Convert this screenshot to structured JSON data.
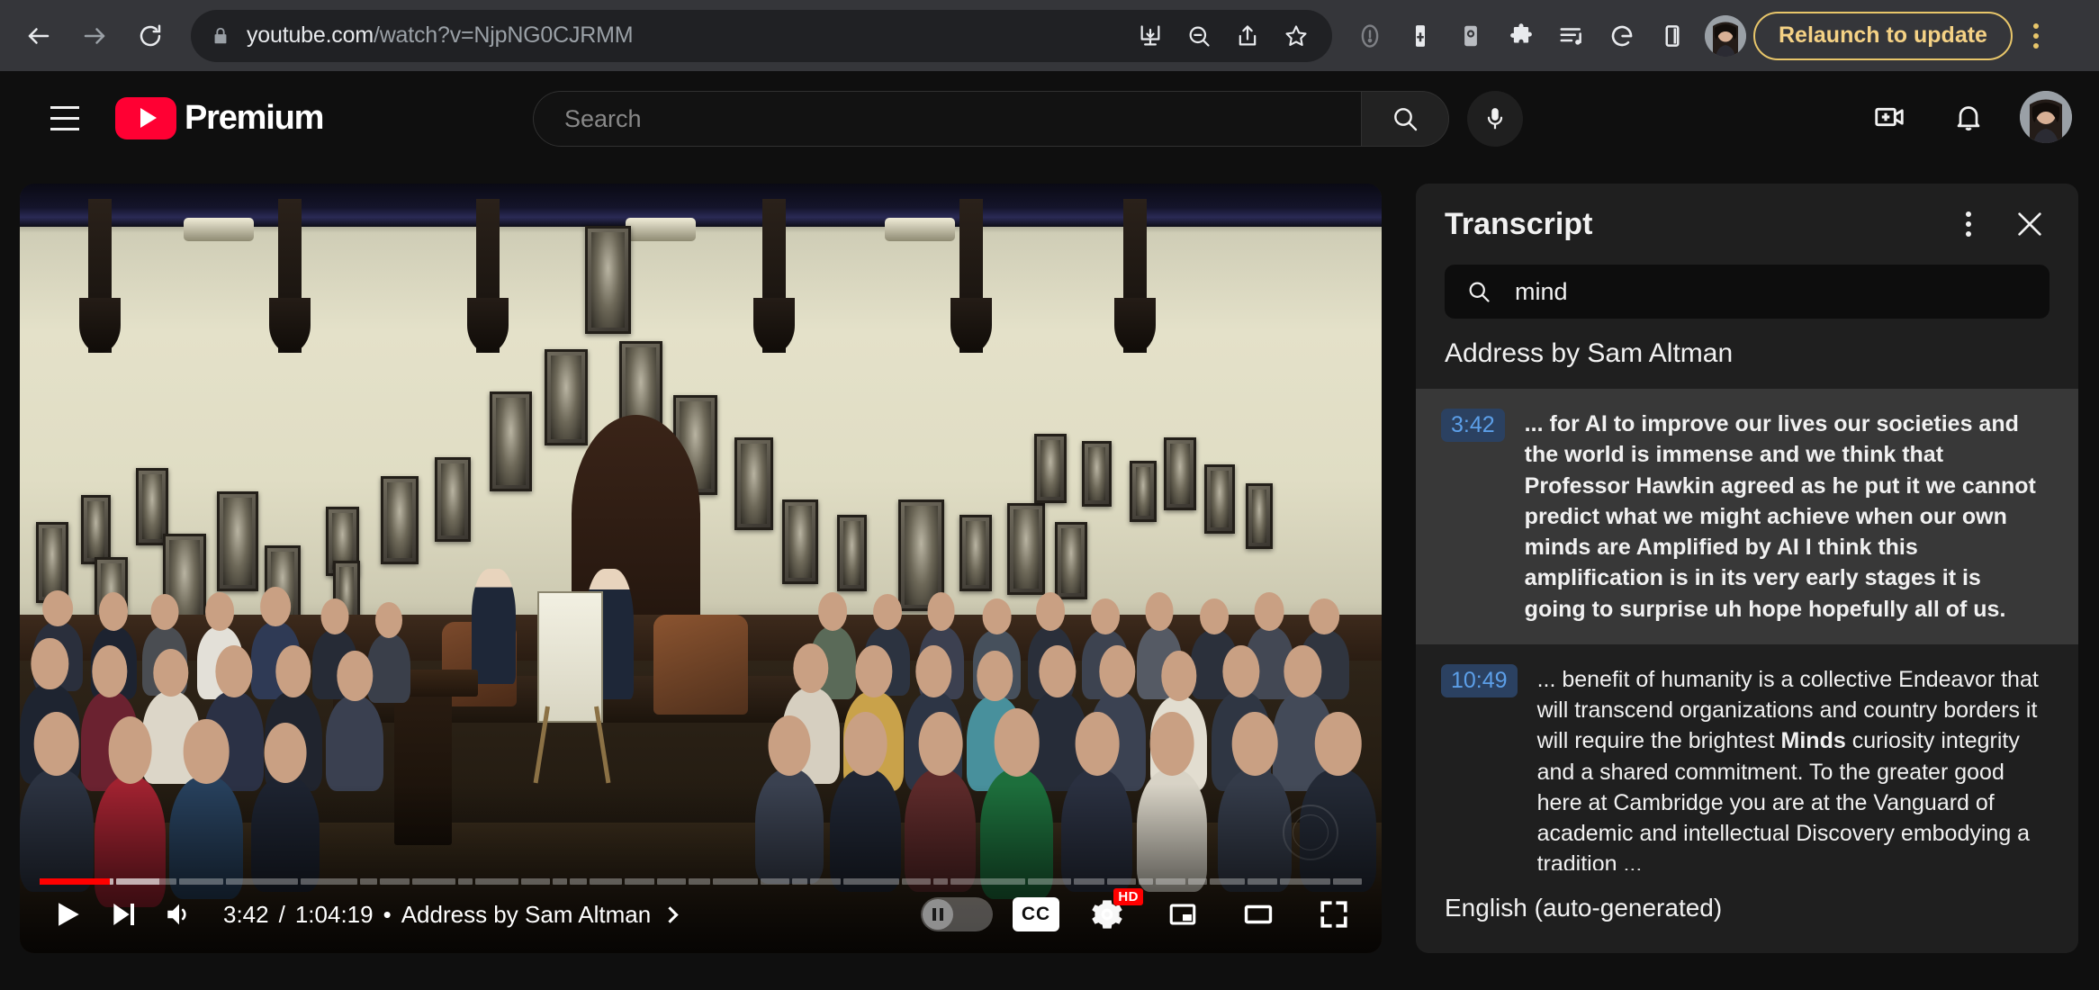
{
  "browser": {
    "nav": {
      "back_icon": "arrow-left-icon",
      "forward_icon": "arrow-right-icon",
      "reload_icon": "reload-icon"
    },
    "omnibox": {
      "lock_icon": "lock-icon",
      "url_domain": "youtube.com",
      "url_path": "/watch?v=NjpNG0CJRMM",
      "actions": [
        {
          "name": "install-app-icon",
          "label": "Install"
        },
        {
          "name": "zoom-out-icon",
          "label": "Zoom out"
        },
        {
          "name": "share-icon",
          "label": "Share"
        },
        {
          "name": "bookmark-star-icon",
          "label": "Bookmark"
        }
      ]
    },
    "extensions": [
      {
        "name": "info-circle-icon",
        "label": "Info"
      },
      {
        "name": "password-manager-icon",
        "label": "Password Manager"
      },
      {
        "name": "screenshot-camera-icon",
        "label": "Screenshot"
      },
      {
        "name": "puzzle-extensions-icon",
        "label": "Extensions"
      },
      {
        "name": "playlist-queue-icon",
        "label": "Playlist"
      },
      {
        "name": "google-g-icon",
        "label": "Google"
      },
      {
        "name": "side-panel-icon",
        "label": "Side panel"
      }
    ],
    "profile_icon": "profile-avatar",
    "relaunch_label": "Relaunch to update",
    "chrome_menu_icon": "three-dots-vertical-icon"
  },
  "youtube": {
    "header": {
      "menu_icon": "hamburger-menu-icon",
      "logo_text": "Premium",
      "logo_icon": "youtube-play-logo",
      "search_placeholder": "Search",
      "search_icon": "search-icon",
      "mic_icon": "microphone-icon",
      "create_icon": "create-video-icon",
      "notifications_icon": "notifications-bell-icon",
      "avatar_icon": "account-avatar"
    },
    "player": {
      "play_icon": "play-icon",
      "next_icon": "next-video-icon",
      "volume_icon": "volume-icon",
      "current_time": "3:42",
      "duration": "1:04:19",
      "separator": "•",
      "chapter_title": "Address by Sam Altman",
      "chapter_chevron_icon": "chevron-right-icon",
      "autoplay_icon": "autoplay-toggle",
      "captions_label": "CC",
      "captions_icon": "closed-captions-icon",
      "settings_icon": "settings-gear-icon",
      "quality_badge": "HD",
      "miniplayer_icon": "miniplayer-icon",
      "theater_icon": "theater-mode-icon",
      "fullscreen_icon": "fullscreen-icon",
      "progress_percent": 5.7,
      "buffered_percent": 9.5
    },
    "transcript": {
      "title": "Transcript",
      "menu_icon": "three-dots-vertical-icon",
      "close_icon": "close-x-icon",
      "search_icon": "search-icon",
      "search_value": "mind",
      "section_title": "Address by Sam Altman",
      "language": "English (auto-generated)",
      "entries": [
        {
          "time": "3:42",
          "active": true,
          "text": "... for AI to improve our lives our societies and the world is immense and we think that Professor Hawkin agreed as he put it we cannot predict what we might achieve when our own minds are Amplified by AI I think this amplification is in its very early stages it is going to surprise uh hope hopefully all of us."
        },
        {
          "time": "10:49",
          "active": false,
          "text_before": "... benefit of humanity is a collective Endeavor that will transcend organizations and country borders it will require the brightest ",
          "text_highlight": "Minds",
          "text_after": " curiosity integrity and a shared commitment. To the greater good here at Cambridge you are at the Vanguard of academic and intellectual Discovery embodying a tradition ..."
        }
      ]
    }
  },
  "colors": {
    "brand_red": "#ff0033",
    "progress_red": "#ff0000",
    "panel_bg": "#1f1f1f",
    "active_row_bg": "#383838",
    "timestamp_text": "#5c9fe8",
    "timestamp_bg": "#2b4161",
    "relaunch_accent": "#e8c66a",
    "browser_bar_bg": "#35363a",
    "page_bg": "#0f0f0f"
  }
}
